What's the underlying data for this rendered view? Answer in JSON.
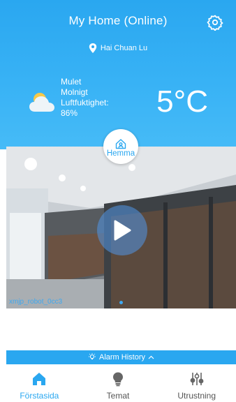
{
  "header": {
    "title": "My Home (Online)",
    "location": "Hai Chuan Lu",
    "accent_color": "#2aa7f0"
  },
  "weather": {
    "condition_1": "Mulet",
    "condition_2": "Molnigt",
    "humidity_label": "Luftfuktighet:",
    "humidity_value": "86%",
    "temperature": "5°C",
    "icon": "partly-cloudy-icon"
  },
  "mode_button": {
    "label": "Hemma",
    "icon": "home-mode-icon"
  },
  "camera": {
    "name": "xmjp_robot_0cc3",
    "play_icon": "play-icon"
  },
  "alarm_history": {
    "label": "Alarm History",
    "icon": "lightbulb-icon",
    "chevron": "chevron-up-icon"
  },
  "bottom_nav": {
    "items": [
      {
        "label": "Förstasida",
        "icon": "home-icon",
        "active": true
      },
      {
        "label": "Temat",
        "icon": "bulb-icon",
        "active": false
      },
      {
        "label": "Utrustning",
        "icon": "sliders-icon",
        "active": false
      }
    ]
  }
}
